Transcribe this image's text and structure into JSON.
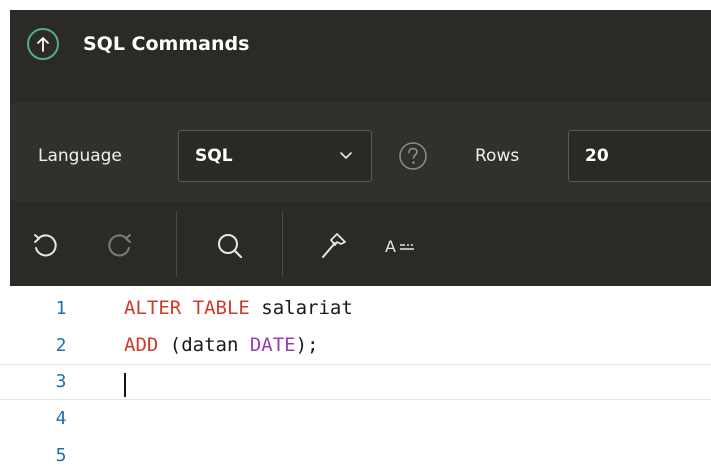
{
  "header": {
    "title": "SQL Commands",
    "up_icon": "arrow-up-circle-icon",
    "accent_color": "#4fae8a"
  },
  "params": {
    "language_label": "Language",
    "language_value": "SQL",
    "help_icon": "question-circle-icon",
    "rows_label": "Rows",
    "rows_value": "20"
  },
  "toolbar": {
    "undo_icon": "undo-icon",
    "redo_icon": "redo-icon",
    "find_icon": "search-icon",
    "format_icon": "hammer-icon",
    "autocomplete_icon": "autocomplete-icon",
    "autocomplete_label": "A"
  },
  "editor": {
    "line_numbers": [
      "1",
      "2",
      "3",
      "4",
      "5"
    ],
    "lines": [
      [
        {
          "text": "ALTER TABLE",
          "cls": "kw"
        },
        {
          "text": " salariat",
          "cls": ""
        }
      ],
      [
        {
          "text": "ADD",
          "cls": "kw"
        },
        {
          "text": " (datan ",
          "cls": ""
        },
        {
          "text": "DATE",
          "cls": "type"
        },
        {
          "text": ");",
          "cls": ""
        }
      ],
      [],
      [],
      []
    ],
    "active_line": "3",
    "keyword_color": "#d03a2b",
    "type_color": "#9a3cb6",
    "line_number_color": "#1f6fb2"
  }
}
